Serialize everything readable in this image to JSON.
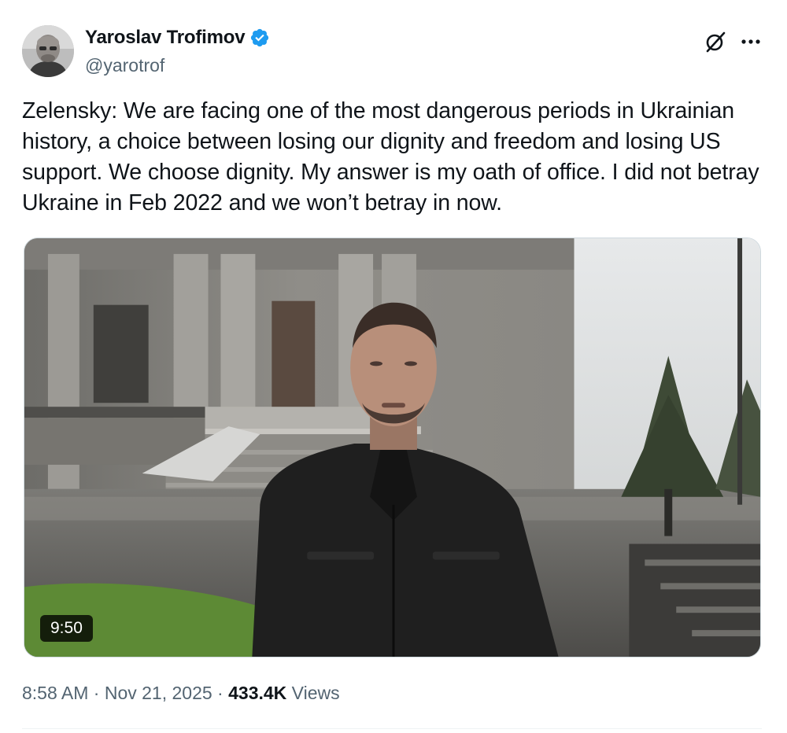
{
  "author": {
    "display_name": "Yaroslav Trofimov",
    "handle": "@yarotrof",
    "verified_icon": "verified-badge-icon",
    "avatar_icon": "avatar-photo"
  },
  "actions": {
    "grok_icon": "grok-slashed-circle-icon",
    "more_icon": "more-dots-icon"
  },
  "tweet": {
    "text": "Zelensky: We are facing one of the most dangerous periods in Ukrainian history, a choice between losing our dignity and freedom and losing US support. We choose dignity. My answer is my oath of office. I did not betray Ukraine in Feb 2022 and we won’t betray in now."
  },
  "media": {
    "type": "video",
    "duration": "9:50"
  },
  "meta": {
    "time": "8:58 AM",
    "separator": " · ",
    "date": "Nov 21, 2025",
    "views_count": "433.4K",
    "views_label": " Views"
  },
  "colors": {
    "text": "#0f1419",
    "secondary": "#536471",
    "verified": "#1d9bf0"
  }
}
